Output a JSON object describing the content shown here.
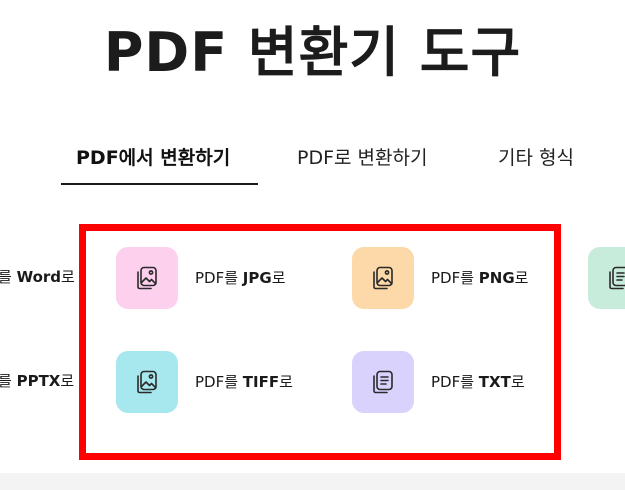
{
  "title": "PDF 변환기 도구",
  "tabs": [
    {
      "label": "PDF에서 변환하기",
      "active": true
    },
    {
      "label": "PDF로 변환하기",
      "active": false
    },
    {
      "label": "기타 형식",
      "active": false
    }
  ],
  "partial_items": {
    "left_top": {
      "prefix": "를 ",
      "format": "Word",
      "suffix": "로"
    },
    "left_bottom": {
      "prefix": "를 ",
      "format": "PPTX",
      "suffix": "로"
    }
  },
  "items": [
    {
      "prefix": "PDF를 ",
      "format": "JPG",
      "suffix": "로",
      "icon": "image-file-icon",
      "color": "#fdd0ee"
    },
    {
      "prefix": "PDF를 ",
      "format": "PNG",
      "suffix": "로",
      "icon": "image-file-icon",
      "color": "#fdd8a8"
    },
    {
      "prefix": "PDF를 ",
      "format": "TIFF",
      "suffix": "로",
      "icon": "image-file-icon",
      "color": "#a6e8ee"
    },
    {
      "prefix": "PDF를 ",
      "format": "TXT",
      "suffix": "로",
      "icon": "text-file-icon",
      "color": "#d8d2fc"
    }
  ],
  "partial_right": {
    "icon": "text-file-icon",
    "color": "#c8ecdc"
  },
  "colors": {
    "highlight": "#ff0000",
    "text": "#1a1a1a",
    "footer": "#f3f3f3"
  }
}
